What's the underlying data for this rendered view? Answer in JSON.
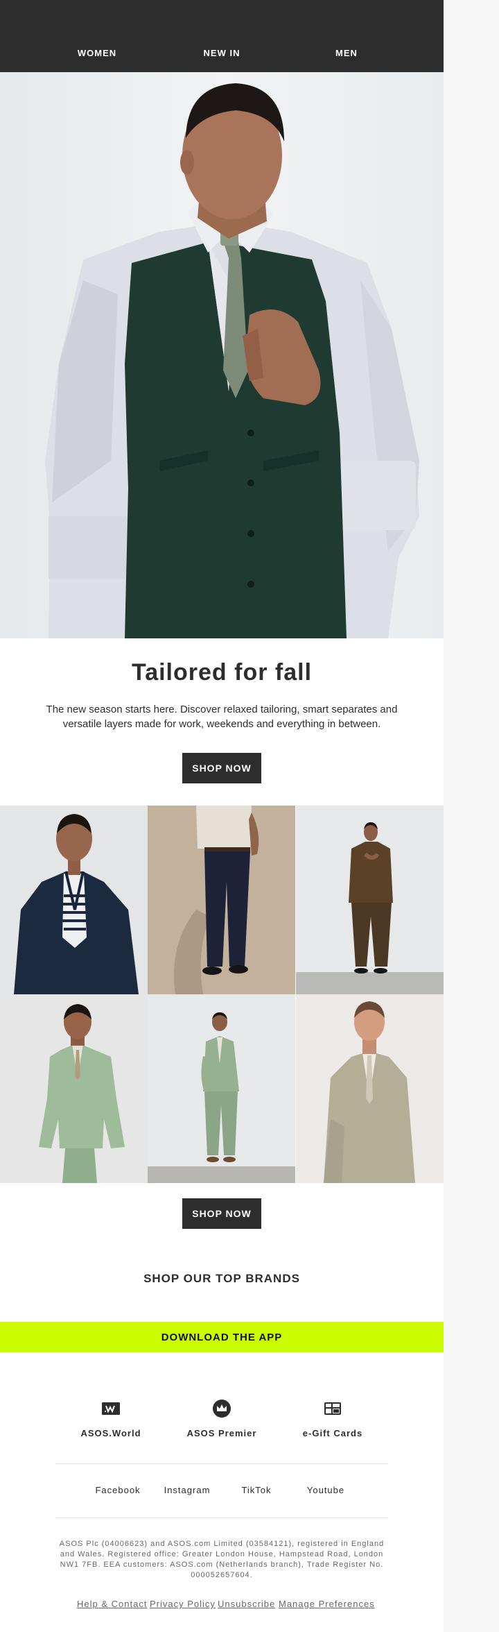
{
  "nav": {
    "items": [
      {
        "label": "WOMEN"
      },
      {
        "label": "NEW IN"
      },
      {
        "label": "MEN"
      }
    ]
  },
  "hero": {
    "headline": "Tailored for fall",
    "body": "The new season starts here. Discover relaxed tailoring, smart separates and versatile layers made for work, weekends and everything in between.",
    "cta": "SHOP NOW"
  },
  "grid": {
    "cta": "SHOP NOW"
  },
  "brands": {
    "title": "SHOP OUR TOP BRANDS"
  },
  "app_bar": {
    "label": "DOWNLOAD THE APP",
    "color": "#cbfd00"
  },
  "services": [
    {
      "label": "ASOS.World",
      "icon": "asos-world-icon"
    },
    {
      "label": "ASOS Premier",
      "icon": "crown-icon"
    },
    {
      "label": "e-Gift Cards",
      "icon": "gift-card-icon"
    }
  ],
  "social": [
    {
      "label": "Facebook"
    },
    {
      "label": "Instagram"
    },
    {
      "label": "TikTok"
    },
    {
      "label": "Youtube"
    }
  ],
  "legal": "ASOS Plc (04006623) and ASOS.com Limited (03584121), registered in England and Wales. Registered office: Greater London House, Hampstead Road, London NW1 7FB. EEA customers: ASOS.com (Netherlands branch), Trade Register No. 000052657604.",
  "footer_links": [
    {
      "label": "Help & Contact"
    },
    {
      "label": "Privacy Policy"
    },
    {
      "label": "Unsubscribe"
    },
    {
      "label": "Manage Preferences"
    }
  ],
  "colors": {
    "nav_background": "#2d2d2d",
    "button_background": "#2d2d2d",
    "accent": "#cbfd00",
    "page_background": "#f7f7f7"
  }
}
